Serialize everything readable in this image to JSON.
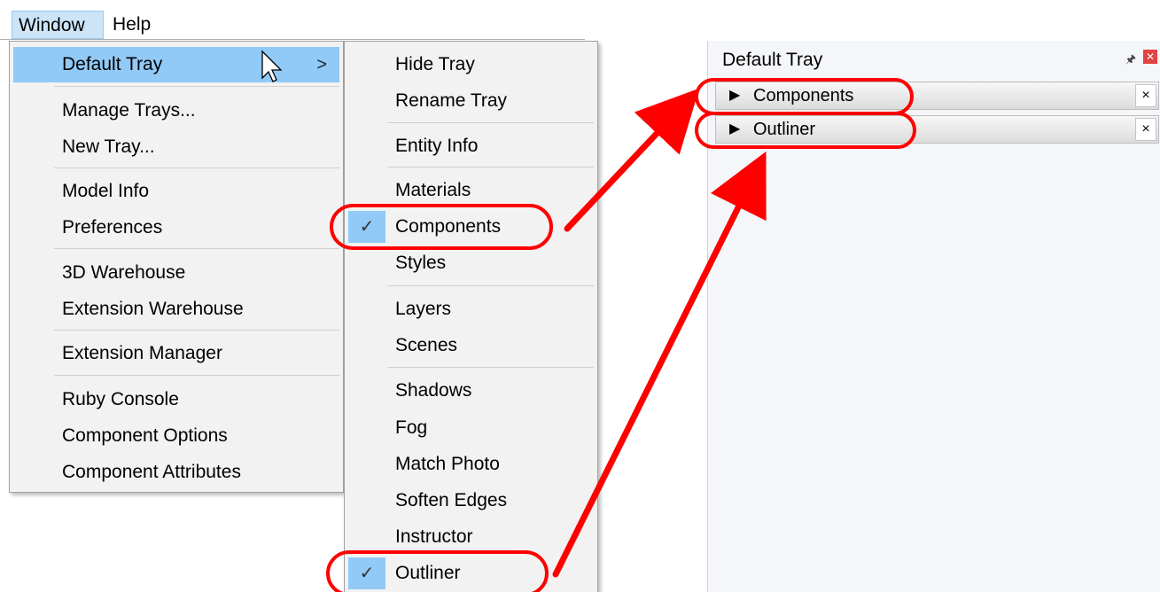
{
  "menubar": {
    "items": [
      "Window",
      "Help"
    ]
  },
  "main_menu": {
    "items": [
      "Default Tray",
      "Manage Trays...",
      "New Tray...",
      "Model Info",
      "Preferences",
      "3D Warehouse",
      "Extension Warehouse",
      "Extension Manager",
      "Ruby Console",
      "Component Options",
      "Component Attributes"
    ],
    "submenu_arrow": ">"
  },
  "submenu": {
    "items": [
      "Hide Tray",
      "Rename Tray",
      "Entity Info",
      "Materials",
      "Components",
      "Styles",
      "Layers",
      "Scenes",
      "Shadows",
      "Fog",
      "Match Photo",
      "Soften Edges",
      "Instructor",
      "Outliner"
    ],
    "checked": [
      "Components",
      "Outliner"
    ],
    "check_glyph": "✓"
  },
  "tray": {
    "title": "Default Tray",
    "panels": [
      "Components",
      "Outliner"
    ],
    "panel_arrow": "▶",
    "panel_close": "×",
    "pin_icon": "pin-icon",
    "close_icon": "close-icon"
  },
  "colors": {
    "highlight": "#91c9f7",
    "annotation": "#ff0000",
    "tray_bg": "#f4f6f9"
  }
}
